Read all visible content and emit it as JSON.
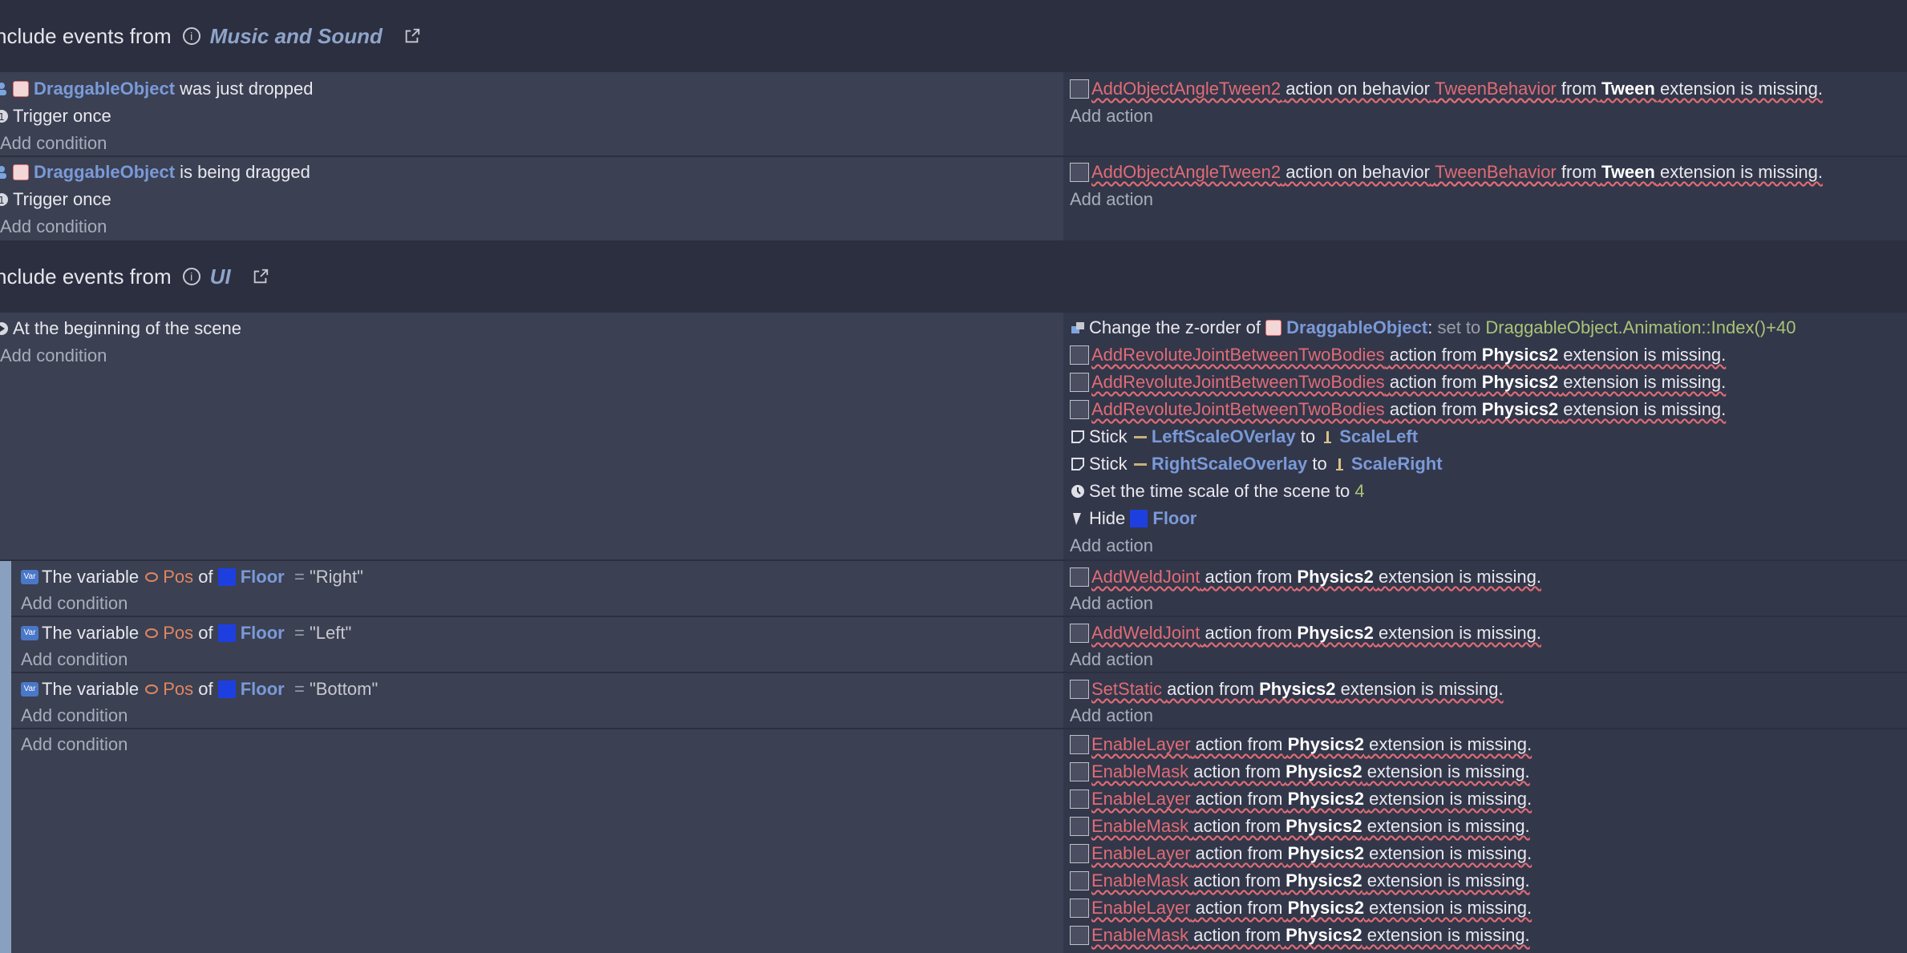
{
  "include1": {
    "prefix": "nclude events from",
    "name": "Music and Sound"
  },
  "event1": {
    "conditions": [
      {
        "object": "DraggableObject",
        "text": "was just dropped"
      },
      {
        "text": "Trigger once"
      }
    ],
    "add_condition": "Add condition",
    "actions": [
      {
        "name": "AddObjectAngleTween2",
        "mid": "action on behavior",
        "behavior": "TweenBehavior",
        "from": "from",
        "ext": "Tween",
        "tail": "extension is missing."
      }
    ],
    "add_action": "Add action"
  },
  "event2": {
    "conditions": [
      {
        "object": "DraggableObject",
        "text": "is being dragged"
      },
      {
        "text": "Trigger once"
      }
    ],
    "add_condition": "Add condition",
    "actions": [
      {
        "name": "AddObjectAngleTween2",
        "mid": "action on behavior",
        "behavior": "TweenBehavior",
        "from": "from",
        "ext": "Tween",
        "tail": "extension is missing."
      }
    ],
    "add_action": "Add action"
  },
  "include2": {
    "prefix": "nclude events from",
    "name": "UI"
  },
  "event3": {
    "condition": "At the beginning of the scene",
    "add_condition": "Add condition",
    "zorder": {
      "prefix": "Change the z-order of",
      "object": "DraggableObject",
      "colon": ":",
      "set": "set to",
      "value": "DraggableObject.Animation::Index()+40"
    },
    "missing_prefix": "AddRevoluteJointBetweenTwoBodies",
    "missing_mid": "action from",
    "missing_ext": "Physics2",
    "missing_tail": "extension is missing.",
    "stick1": {
      "label": "Stick",
      "obj": "LeftScaleOVerlay",
      "to": "to",
      "target": "ScaleLeft"
    },
    "stick2": {
      "label": "Stick",
      "obj": "RightScaleOverlay",
      "to": "to",
      "target": "ScaleRight"
    },
    "timescale": {
      "text": "Set the time scale of the scene to",
      "value": "4"
    },
    "hide": {
      "text": "Hide",
      "object": "Floor"
    },
    "add_action": "Add action"
  },
  "sub_events": [
    {
      "prefix": "The variable",
      "var": "Pos",
      "of": "of",
      "object": "Floor",
      "eq": "=",
      "value": "\"Right\"",
      "add_condition": "Add condition",
      "action_name": "AddWeldJoint",
      "action_mid": "action from",
      "action_ext": "Physics2",
      "action_tail": "extension is missing.",
      "add_action": "Add action"
    },
    {
      "prefix": "The variable",
      "var": "Pos",
      "of": "of",
      "object": "Floor",
      "eq": "=",
      "value": "\"Left\"",
      "add_condition": "Add condition",
      "action_name": "AddWeldJoint",
      "action_mid": "action from",
      "action_ext": "Physics2",
      "action_tail": "extension is missing.",
      "add_action": "Add action"
    },
    {
      "prefix": "The variable",
      "var": "Pos",
      "of": "of",
      "object": "Floor",
      "eq": "=",
      "value": "\"Bottom\"",
      "add_condition": "Add condition",
      "action_name": "SetStatic",
      "action_mid": "action from",
      "action_ext": "Physics2",
      "action_tail": "extension is missing.",
      "add_action": "Add action"
    }
  ],
  "last_event": {
    "add_condition": "Add condition",
    "actions": [
      "EnableLayer",
      "EnableMask",
      "EnableLayer",
      "EnableMask",
      "EnableLayer",
      "EnableMask",
      "EnableLayer",
      "EnableMask"
    ],
    "mid": "action from",
    "ext": "Physics2",
    "tail": "extension is missing."
  }
}
